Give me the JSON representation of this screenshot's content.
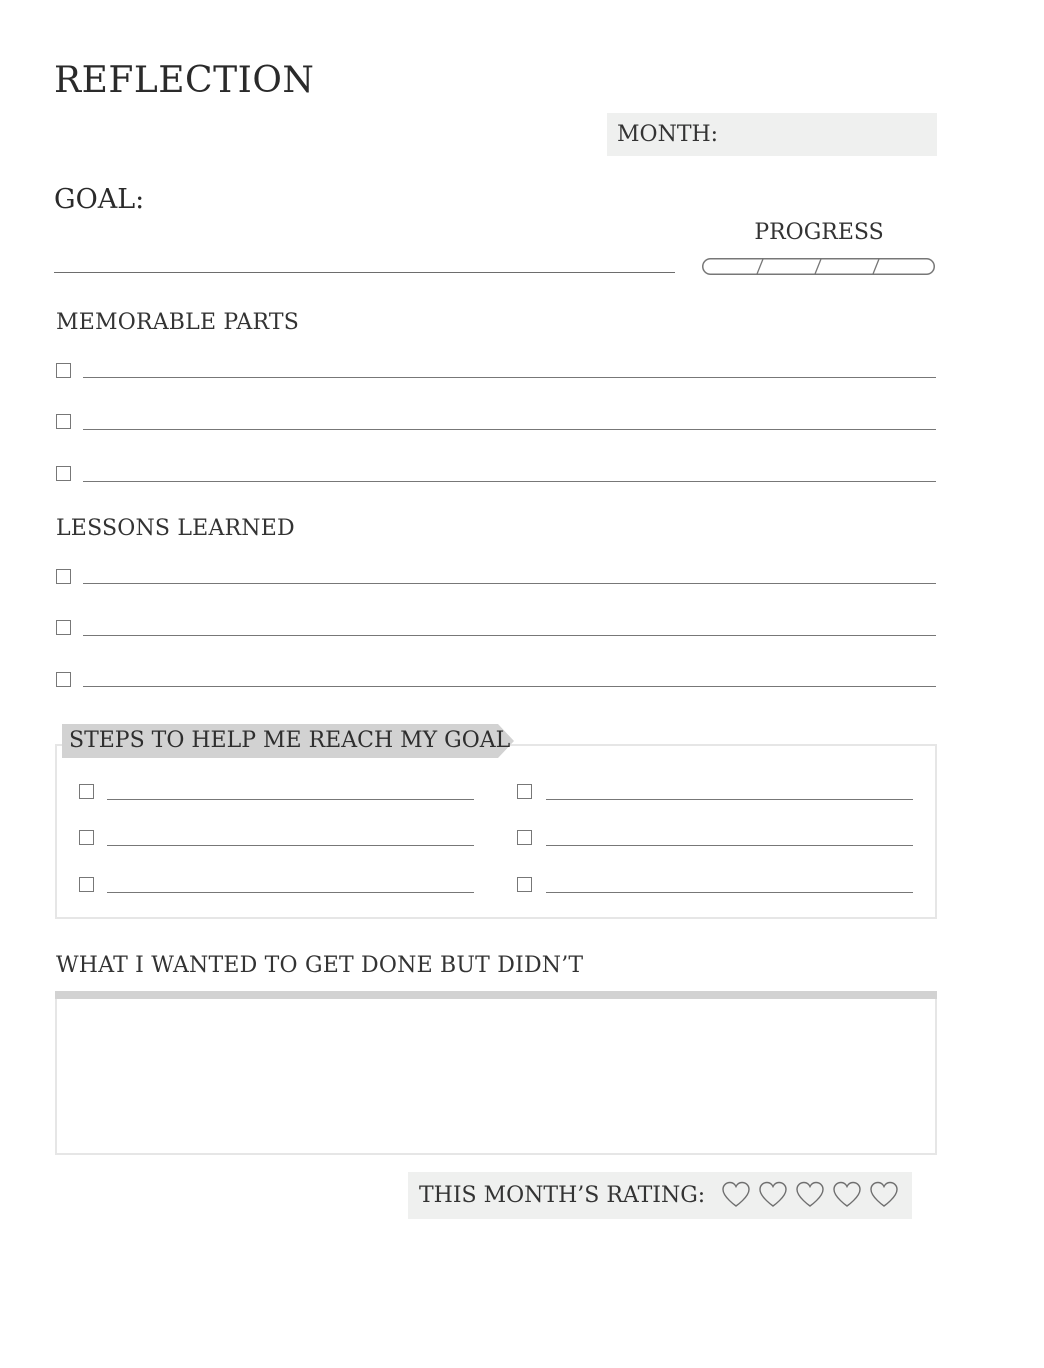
{
  "page": {
    "title": "REFLECTION",
    "month_label": "MONTH:",
    "goal_label": "GOAL:",
    "progress_label": "PROGRESS",
    "progress_segments": 4
  },
  "memorable": {
    "label": "MEMORABLE PARTS",
    "items": [
      "",
      "",
      ""
    ]
  },
  "lessons": {
    "label": "LESSONS LEARNED",
    "items": [
      "",
      "",
      ""
    ]
  },
  "steps": {
    "label": "STEPS TO HELP ME REACH MY GOAL",
    "left_items": [
      "",
      "",
      ""
    ],
    "right_items": [
      "",
      "",
      ""
    ]
  },
  "wanted": {
    "label": "WHAT I WANTED TO GET DONE BUT DIDN’T"
  },
  "rating": {
    "label": "THIS MONTH’S RATING:",
    "max": 5,
    "value": 0,
    "icon": "heart-icon"
  },
  "colors": {
    "label_fill": "#eff0ef",
    "tab_fill": "#d2d2d2",
    "line": "#777777"
  }
}
